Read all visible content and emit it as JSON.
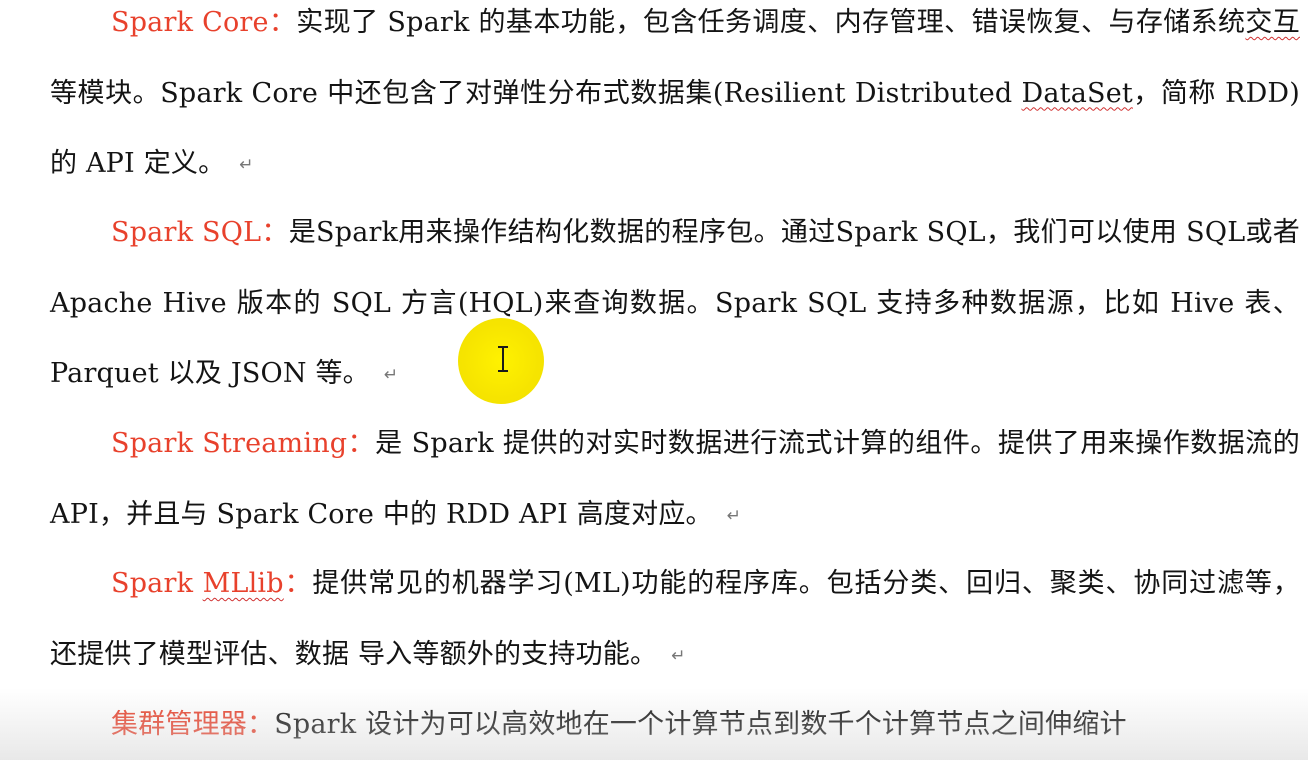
{
  "document": {
    "paragraphs": [
      {
        "term": "Spark Core：",
        "segments": [
          {
            "text": "实现了 Spark 的基本功能，包含任务调度、内存管理、错误恢复、与存储系统"
          },
          {
            "text": "交互",
            "squiggle": true
          },
          {
            "text": "等模块。Spark Core 中还包含了对弹性分布式数据集(Resilient Distributed "
          },
          {
            "text": "DataSet",
            "squiggle": true
          },
          {
            "text": "，简称 RDD)的 API 定义。"
          }
        ]
      },
      {
        "term": "Spark SQL：",
        "segments": [
          {
            "text": "是Spark用来操作结构化数据的程序包。通过Spark SQL，我们可以使用 SQL或者 Apache Hive 版本的 SQL 方言(HQL)来查询数据。Spark SQL 支持多种数据源，比如 Hive 表、Parquet 以及 JSON 等。"
          }
        ]
      },
      {
        "term": "Spark Streaming：",
        "segments": [
          {
            "text": "是 Spark 提供的对实时数据进行流式计算的组件。提供了用来操作数据流的 API，并且与 Spark Core 中的 RDD API 高度对应。"
          }
        ]
      },
      {
        "term_parts": [
          {
            "text": "Spark "
          },
          {
            "text": "MLlib",
            "squiggle": true
          },
          {
            "text": "："
          }
        ],
        "segments": [
          {
            "text": "提供常见的机器学习(ML)功能的程序库。包括分类、回归、聚类、协同过滤等，还提供了模型评估、数据 导入等额外的支持功能。"
          }
        ]
      },
      {
        "term": "集群管理器：",
        "segments": [
          {
            "text": "Spark 设计为可以高效地在一个计算节点到数千个计算节点之间伸缩计"
          }
        ]
      }
    ],
    "paragraph_mark": "↵"
  },
  "overlay": {
    "cursor_icon": "ibeam-cursor-icon",
    "highlight_color": "#fff200"
  },
  "colors": {
    "term": "#e8412c",
    "body_text": "#141414",
    "spell_underline": "#d03030"
  }
}
